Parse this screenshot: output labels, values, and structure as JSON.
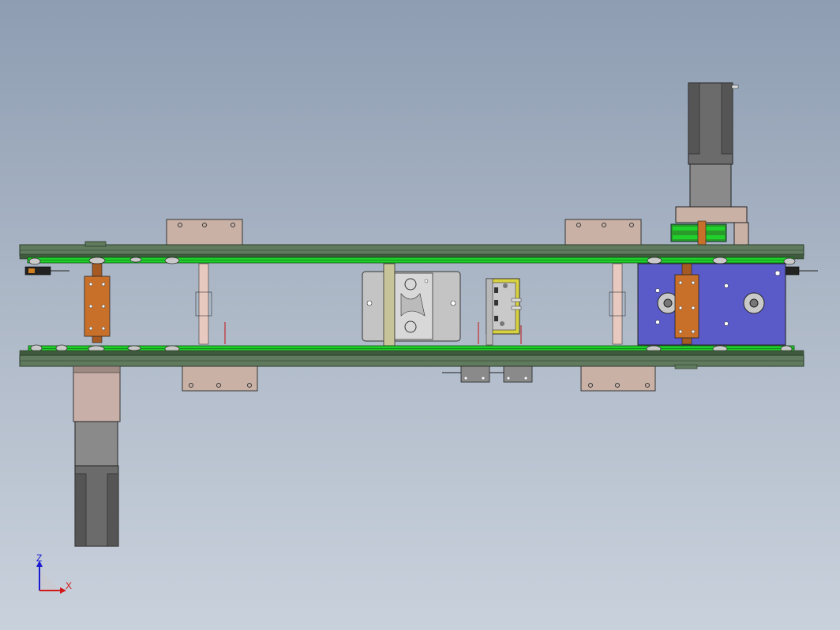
{
  "view": {
    "triad": {
      "z_label": "Z",
      "x_label": "X",
      "z_color": "#1a1ad0",
      "x_color": "#d01a1a"
    }
  },
  "colors": {
    "frame_plate": "#5f7a5c",
    "frame_edge": "#2b3b2a",
    "chain": "#1fd12a",
    "bracket": "#c9b1a6",
    "motor_body": "#7d7d7d",
    "motor_dark": "#555555",
    "motor_cap": "#c8b0a8",
    "shaft_copper": "#c8702a",
    "blue_module": "#5a5ac8",
    "fixture_gray": "#c4c4c4",
    "yellow_part": "#d8d240",
    "roller": "#c9c9c9",
    "guide_rod": "#e8c9c0"
  }
}
